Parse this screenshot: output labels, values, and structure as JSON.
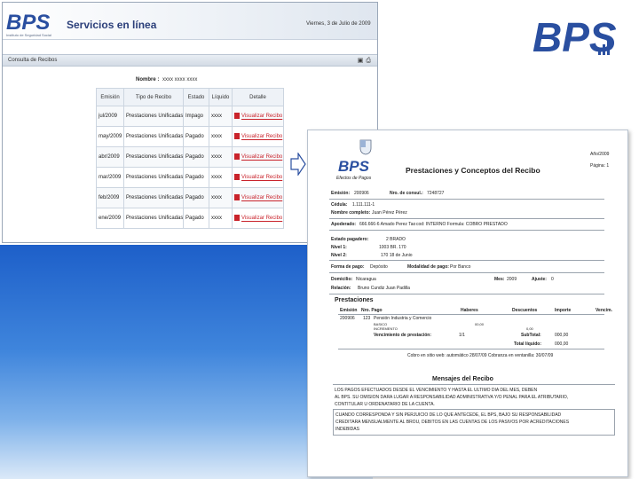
{
  "slide": {
    "logo_text": "BPS",
    "colors": {
      "brand_blue": "#2a4fa0",
      "accent_red": "#c9232b",
      "bg_blue": "#1d5fc9"
    }
  },
  "window": {
    "logo_text": "BPS",
    "logo_subtitle": "Instituto de Seguridad Social",
    "title": "Servicios en línea",
    "date": "Viernes, 3 de Julio de 2009",
    "section_title": "Consulta de Recibos",
    "section_icons": [
      "print-icon",
      "disk-icon"
    ],
    "nombre_label": "Nombre :",
    "nombre_value": "xxxx xxxx xxxx",
    "table": {
      "headers": [
        "Emisión",
        "Tipo de Recibo",
        "Estado",
        "Líquido",
        "Detalle"
      ],
      "rows": [
        {
          "emision": "jul/2009",
          "tipo": "Prestaciones Unificadas",
          "estado": "Impago",
          "liquido": "xxxx",
          "detalle": "Visualizar Recibo"
        },
        {
          "emision": "may/2009",
          "tipo": "Prestaciones Unificadas",
          "estado": "Pagado",
          "liquido": "xxxx",
          "detalle": "Visualizar Recibo"
        },
        {
          "emision": "abr/2009",
          "tipo": "Prestaciones Unificadas",
          "estado": "Pagado",
          "liquido": "xxxx",
          "detalle": "Visualizar Recibo"
        },
        {
          "emision": "mar/2009",
          "tipo": "Prestaciones Unificadas",
          "estado": "Pagado",
          "liquido": "xxxx",
          "detalle": "Visualizar Recibo"
        },
        {
          "emision": "feb/2009",
          "tipo": "Prestaciones Unificadas",
          "estado": "Pagado",
          "liquido": "xxxx",
          "detalle": "Visualizar Recibo"
        },
        {
          "emision": "ene/2009",
          "tipo": "Prestaciones Unificadas",
          "estado": "Pagado",
          "liquido": "xxxx",
          "detalle": "Visualizar Recibo"
        }
      ]
    }
  },
  "receipt": {
    "logo_text": "BPS",
    "logo_subtitle": "Efectos de Pagos",
    "title": "Prestaciones y Conceptos del Recibo",
    "top_right": [
      "Año/2009",
      "Página: 1"
    ],
    "fields": {
      "emision_label": "Emisión:",
      "emision_value": "200906",
      "nro_label": "Nro. de consul.:",
      "nro_value": "7248727",
      "cedula_label": "Cédula:",
      "cedula_value": "1.111.111-1",
      "nombre_label": "Nombre completo:",
      "nombre_value": "Juan Pérez Pérez",
      "apoderado_label": "Apoderado:",
      "apoderado_value": "666.666-6  Amado Perez Tao",
      "apoderado_extra": "cod: INTERNO Formula: COBRO PRESTADO",
      "estado_label": "Estado pagadero:",
      "estado_value": "2 BRADO",
      "nivel1_label": "Nivel 1:",
      "nivel1_value": "1003  BR. 170",
      "nivel2_label": "Nivel 2:",
      "nivel2_value": "170  18 de Junio",
      "forma_label": "Forma de pago:",
      "forma_value": "Depósito",
      "modalidad_label": "Modalidad de pago:",
      "modalidad_value": "Por Banco",
      "mes_label": "Mes:",
      "mes_value": "2009",
      "ajuste_label": "Ajuste:",
      "ajuste_value": "0",
      "domicilio_label": "Domicilio:",
      "domicilio_value": "Nicaragua",
      "relacion_label": "Relación:",
      "relacion_value": "Bruno Cundiz  Juan Padilla"
    },
    "prestaciones": {
      "title": "Prestaciones",
      "headers": [
        "Emisión",
        "Nro. Pago",
        "Haberes",
        "Descuentos",
        "Importe",
        "Vencim."
      ],
      "row_date": "200906",
      "row_code": "123",
      "row_desc": "Pensión Industria y Comercio",
      "sub_lines": [
        "BASICO",
        "INCREMENTO"
      ],
      "mid_value": "00,00",
      "right_value": "0,00",
      "venc_label": "Vencimiento de prestación:",
      "venc_value": "1/1",
      "subtotal_label": "SubTotal:",
      "subtotal_value": "000,00",
      "total_label": "Total líquido:",
      "total_value": "000,00",
      "cobro_text": "Cobro en sitio web: automático 28/07/09  Cobranza en ventanilla: 30/07/09"
    },
    "mensajes": {
      "title": "Mensajes del Recibo",
      "msg1": "LOS PAGOS EFECTUADOS DESDE EL VENCIMIENTO Y HASTA EL ULTIMO DIA DEL MES, DEBEN ENVIARSE AL BPS. SU OMISION DARA LUGAR A RESPONSABILIDAD ADMINISTRATIVA Y/O PENAL PARA EL ATRIBUTARIO, CONTITULAR U ORDENATARIO DE LA CUENTA.",
      "msg1_lines": [
        "LOS PAGOS EFECTUADOS DESDE EL VENCIMIENTO Y HASTA EL ULTIMO DIA DEL MES, DEBEN",
        "AL BPS. SU OMISION DARA LUGAR A RESPONSABILIDAD ADMINISTRATIVA Y/O PENAL PARA EL ATRIBUTARIO,",
        "CONTITULAR U ORDENATARIO DE LA CUENTA."
      ],
      "msg2_lines": [
        "CUANDO CORRESPONDA Y SIN PERJUICIO DE LO QUE ANTECEDE, EL BPS, BAJO SU RESPONSABILIDAD",
        "CREDITARA MENSUALMENTE AL BROU, DEBITOS EN LAS CUENTAS DE LOS PASIVOS POR ACREDITACIONES",
        "INDEBIDAS"
      ]
    }
  }
}
